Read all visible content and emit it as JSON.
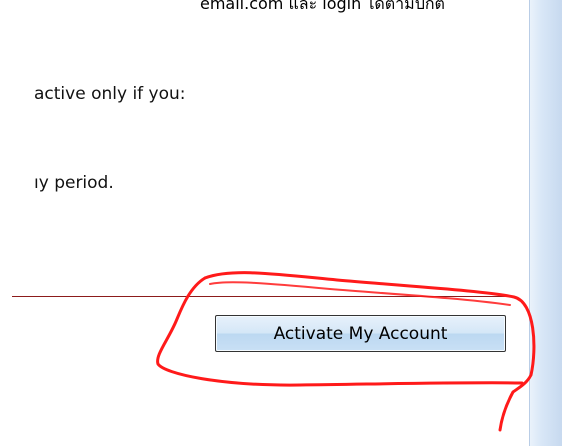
{
  "header": {
    "caption": "email.com และ login ได้ตามปกติ"
  },
  "content": {
    "line_1": "active only if you:",
    "line_2": "ıy period."
  },
  "actions": {
    "activate_label": "Activate My Account"
  },
  "annotation": {
    "type": "red-freehand-outline",
    "target": "activate-my-account-button",
    "color": "#ff1a1a"
  },
  "theme": {
    "button_fill": "#d5e7f7",
    "button_border": "#333333",
    "divider_color": "#8c1b1b",
    "side_panel": "#d9e7f7"
  }
}
